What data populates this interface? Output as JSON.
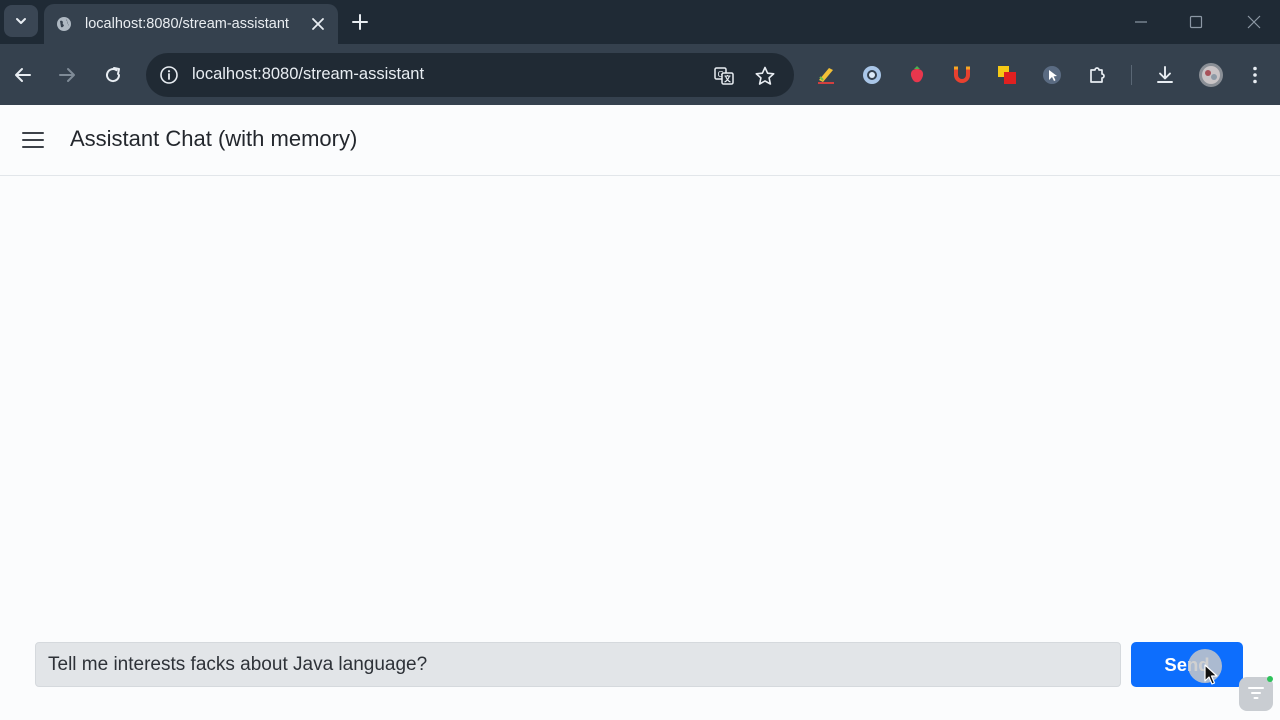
{
  "browser": {
    "tab_title": "localhost:8080/stream-assistant",
    "url": "localhost:8080/stream-assistant",
    "theme": {
      "tabstrip": "#1f2a35",
      "toolbar": "#35414e",
      "omnibox": "#202a34"
    },
    "icons": {
      "tab_search": "chevron-down-icon",
      "favicon": "globe-icon",
      "tab_close": "close-icon",
      "new_tab": "plus-icon",
      "minimize": "minimize-icon",
      "maximize": "maximize-icon",
      "close_window": "close-icon",
      "back": "arrow-left-icon",
      "forward": "arrow-right-icon",
      "reload": "reload-icon",
      "site_info": "info-icon",
      "translate": "translate-icon",
      "bookmark": "star-icon",
      "extensions": [
        "pencil-extension-icon",
        "circle-extension-icon",
        "strawberry-extension-icon",
        "magnet-extension-icon",
        "square-extension-icon",
        "cursor-extension-icon",
        "puzzle-icon"
      ],
      "downloads": "download-icon",
      "profile": "avatar",
      "menu": "kebab-menu-icon"
    }
  },
  "app": {
    "title": "Assistant Chat (with memory)",
    "menu_icon": "hamburger-icon"
  },
  "composer": {
    "value": "Tell me interests facks about Java language?",
    "send_label": "Send",
    "send_color": "#0d6efd"
  }
}
